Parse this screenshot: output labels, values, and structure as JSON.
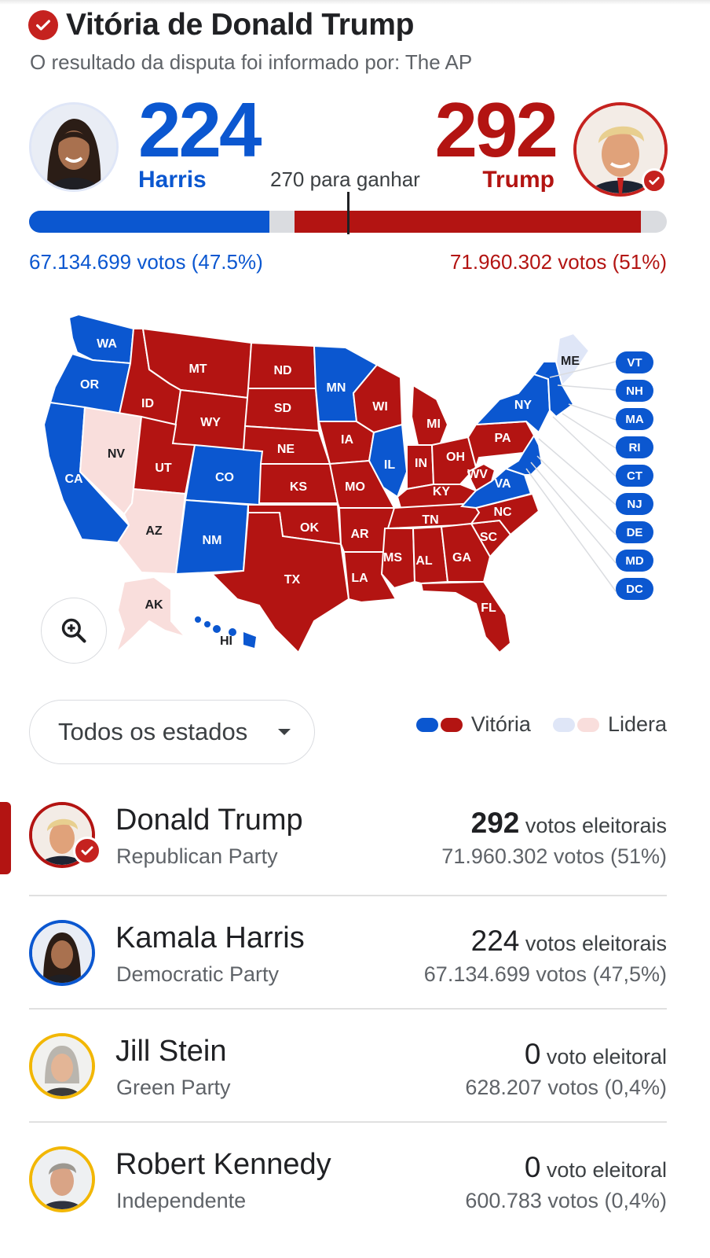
{
  "header": {
    "title": "Vitória de Donald Trump",
    "subtitle": "O resultado da disputa foi informado por: The AP"
  },
  "scoreboard": {
    "harris_ev": "224",
    "harris_name": "Harris",
    "trump_ev": "292",
    "trump_name": "Trump",
    "to_win": "270 para ganhar",
    "harris_votes": "67.134.699 votos (47.5%)",
    "trump_votes": "71.960.302 votos (51%)",
    "bar": {
      "harris_ev": 224,
      "trump_ev": 292,
      "total": 538,
      "threshold": 270
    }
  },
  "colors": {
    "dem_win": "#0b57d0",
    "rep_win": "#b31412",
    "dem_lead": "#dfe6f7",
    "rep_lead": "#f9dedc",
    "accent": "#c5221f"
  },
  "map": {
    "states": {
      "WA": "WA",
      "OR": "OR",
      "CA": "CA",
      "ID": "ID",
      "NV": "NV",
      "MT": "MT",
      "WY": "WY",
      "UT": "UT",
      "AZ": "AZ",
      "CO": "CO",
      "NM": "NM",
      "ND": "ND",
      "SD": "SD",
      "NE": "NE",
      "KS": "KS",
      "OK": "OK",
      "TX": "TX",
      "MN": "MN",
      "IA": "IA",
      "MO": "MO",
      "AR": "AR",
      "LA": "LA",
      "WI": "WI",
      "IL": "IL",
      "MI": "MI",
      "IN": "IN",
      "OH": "OH",
      "KY": "KY",
      "TN": "TN",
      "MS": "MS",
      "AL": "AL",
      "GA": "GA",
      "FL": "FL",
      "SC": "SC",
      "NC": "NC",
      "VA": "VA",
      "WV": "WV",
      "PA": "PA",
      "NY": "NY",
      "ME": "ME",
      "AK": "AK",
      "HI": "HI"
    },
    "small_states": [
      "VT",
      "NH",
      "MA",
      "RI",
      "CT",
      "NJ",
      "DE",
      "MD",
      "DC"
    ],
    "zoom_icon": "zoom-in-icon"
  },
  "filter": {
    "label": "Todos os estados",
    "icon": "dropdown-arrow-icon"
  },
  "legend": {
    "win": "Vitória",
    "lead": "Lidera"
  },
  "candidates": [
    {
      "name": "Donald Trump",
      "party": "Republican Party",
      "ev": "292",
      "ev_label": "votos eleitorais",
      "votes": "71.960.302 votos (51%)",
      "ring": "#b31412"
    },
    {
      "name": "Kamala Harris",
      "party": "Democratic Party",
      "ev": "224",
      "ev_label": "votos eleitorais",
      "votes": "67.134.699 votos (47,5%)",
      "ring": "#0b57d0"
    },
    {
      "name": "Jill Stein",
      "party": "Green Party",
      "ev": "0",
      "ev_label": "voto eleitoral",
      "votes": "628.207 votos (0,4%)",
      "ring": "#f2b705"
    },
    {
      "name": "Robert Kennedy",
      "party": "Independente",
      "ev": "0",
      "ev_label": "voto eleitoral",
      "votes": "600.783 votos (0,4%)",
      "ring": "#f2b705"
    }
  ]
}
